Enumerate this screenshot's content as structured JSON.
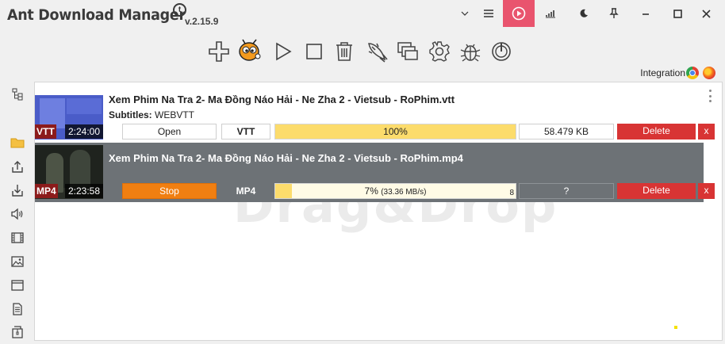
{
  "app": {
    "title": "Ant Download Manager",
    "version": "v.2.15.9",
    "logo_letter": "t"
  },
  "integration": {
    "label": "Integration"
  },
  "watermark": "Drag&Drop",
  "downloads": [
    {
      "filename": "Xem Phim Na Tra 2- Ma Đồng Náo Hải - Ne Zha 2 - Vietsub - RoPhim.vtt",
      "subtitles_label": "Subtitles:",
      "subtitles_value": "WEBVTT",
      "badge": "VTT",
      "duration": "2:24:00",
      "action": "Open",
      "format": "VTT",
      "progress_percent": 100,
      "progress_text": "100%",
      "size": "58.479 KB",
      "delete": "Delete",
      "remove": "x"
    },
    {
      "filename": "Xem Phim Na Tra 2- Ma Đồng Náo Hải - Ne Zha 2 - Vietsub - RoPhim.mp4",
      "badge": "MP4",
      "duration": "2:23:58",
      "action": "Stop",
      "format": "MP4",
      "progress_percent": 7,
      "progress_text": "7%",
      "progress_speed": "(33.36 MB/s)",
      "connections": "8",
      "size": "?",
      "delete": "Delete",
      "remove": "x"
    }
  ],
  "colors": {
    "accent_red": "#e9546e",
    "delete_red": "#d83434",
    "stop_orange": "#f07f11",
    "progress_yellow": "#fcdc6c",
    "selected_row": "#6d7276"
  },
  "icons": {
    "toolbar": [
      "plus-icon",
      "ant-icon",
      "play-icon",
      "stop-icon",
      "trash-icon",
      "rocket-icon",
      "windows-icon",
      "gear-icon",
      "bug-icon",
      "power-icon"
    ],
    "sidebar": [
      "tree-icon",
      "folder-icon",
      "upload-icon",
      "download-icon",
      "audio-icon",
      "video-icon",
      "image-icon",
      "window-icon",
      "document-icon",
      "archive-icon"
    ]
  }
}
